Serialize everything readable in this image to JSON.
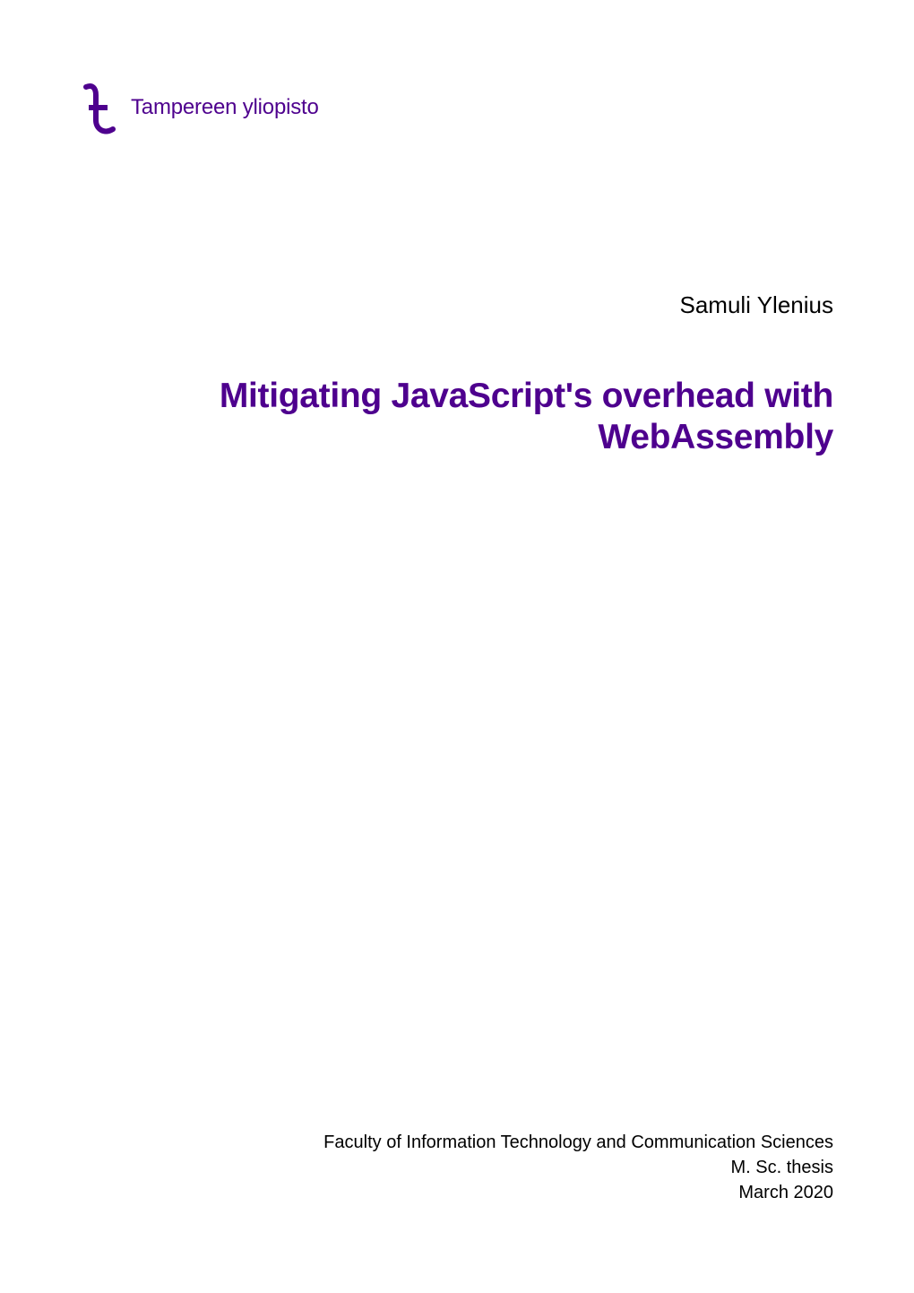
{
  "colors": {
    "brand_purple": "#4e008e",
    "body_text": "#000000"
  },
  "logo": {
    "text": "Tampereen yliopisto",
    "icon_name": "university-logo-icon"
  },
  "author": "Samuli Ylenius",
  "title": {
    "line1": "Mitigating JavaScript's overhead with",
    "line2": "WebAssembly"
  },
  "footer": {
    "faculty": "Faculty of Information Technology and Communication Sciences",
    "document_type": "M. Sc. thesis",
    "date": "March 2020"
  }
}
